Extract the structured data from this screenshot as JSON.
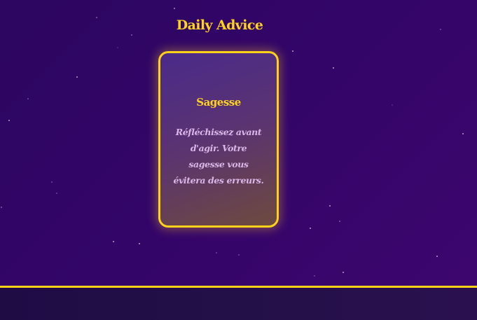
{
  "page": {
    "title": "Daily Advice"
  },
  "card": {
    "title": "Sagesse",
    "text": "Réfléchissez avant d'agir. Votre sagesse vous évitera des erreurs."
  },
  "colors": {
    "accent": "#ffd21f",
    "background": "#330568",
    "card_text": "#d9b7e8",
    "bottom_bar": "#22104a"
  }
}
